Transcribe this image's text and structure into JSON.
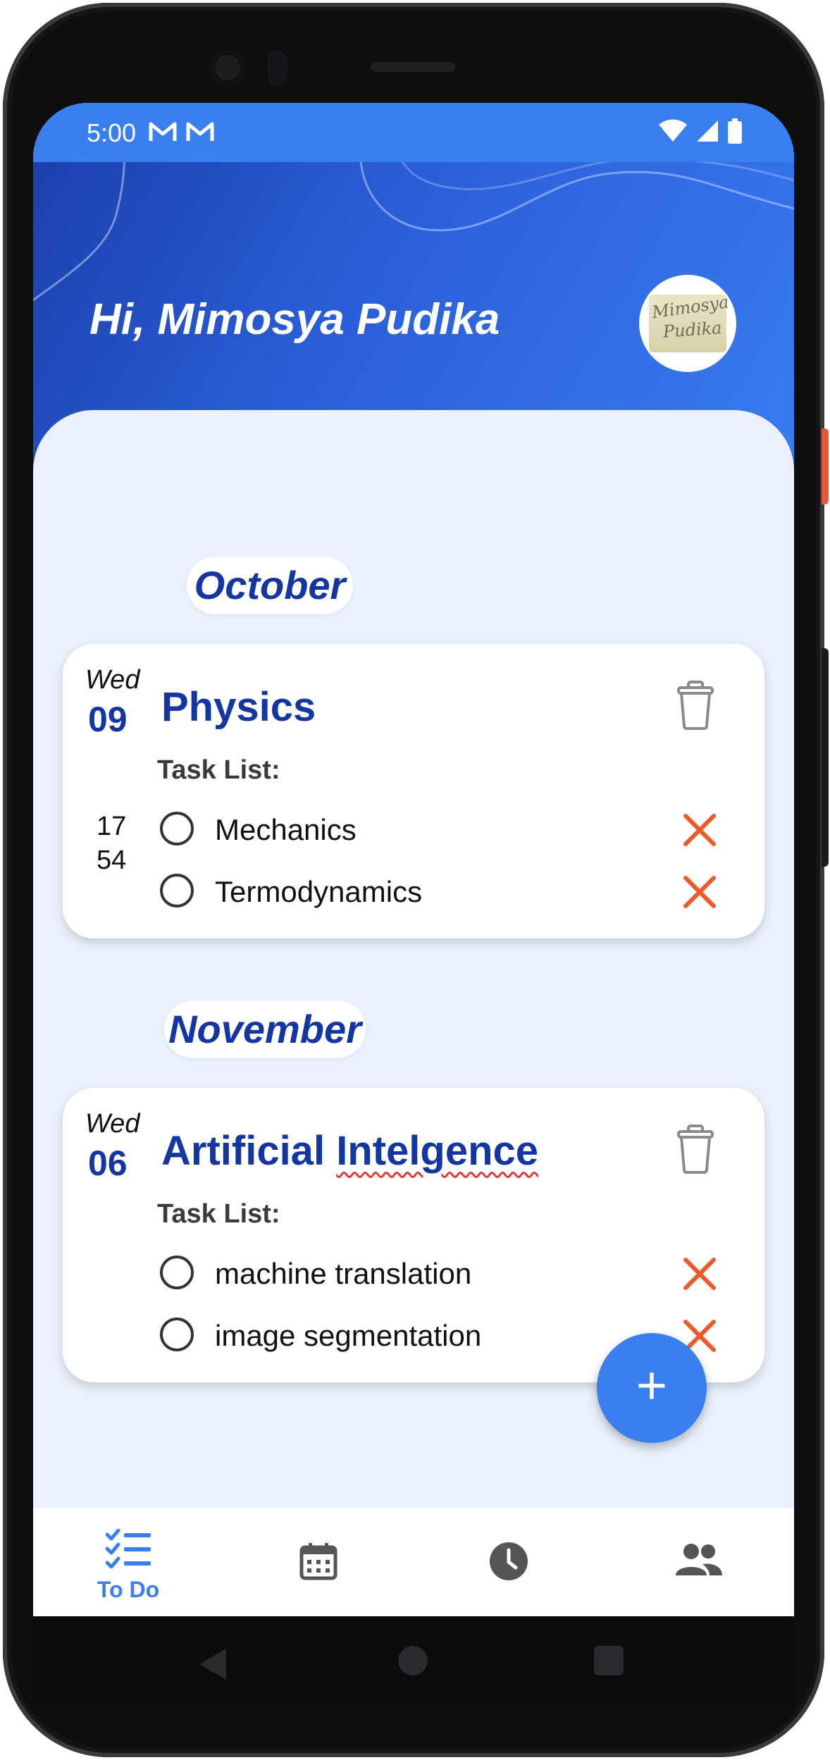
{
  "status_bar": {
    "time": "5:00",
    "notification_icons": [
      "gmail-icon",
      "gmail-icon"
    ],
    "system_icons": [
      "wifi-icon",
      "signal-icon",
      "battery-icon"
    ]
  },
  "header": {
    "greeting": "Hi, Mimosya Pudika",
    "avatar_text_line1": "Mimosya",
    "avatar_text_line2": "Pudika"
  },
  "months": [
    {
      "label": "October",
      "cards": [
        {
          "day_name": "Wed",
          "day_number": "09",
          "time_hour": "17",
          "time_minute": "54",
          "title": "Physics",
          "task_list_label": "Task List:",
          "tasks": [
            "Mechanics",
            "Termodynamics"
          ]
        }
      ]
    },
    {
      "label": "November",
      "cards": [
        {
          "day_name": "Wed",
          "day_number": "06",
          "title_part1": "Artificial",
          "title_part2": "Intelgence",
          "task_list_label": "Task List:",
          "tasks": [
            "machine translation",
            "image segmentation"
          ]
        }
      ]
    }
  ],
  "fab": {
    "label": "+"
  },
  "bottom_nav": {
    "active": "todo",
    "items": [
      {
        "id": "todo",
        "label": "To Do",
        "icon": "checklist-icon"
      },
      {
        "id": "calendar",
        "label": "",
        "icon": "calendar-icon"
      },
      {
        "id": "history",
        "label": "",
        "icon": "clock-icon"
      },
      {
        "id": "people",
        "label": "",
        "icon": "people-icon"
      }
    ]
  },
  "colors": {
    "primary": "#3a7ff0",
    "heading_blue": "#1436a3",
    "delete_x": "#f05a2b",
    "background": "#ebf1fc"
  }
}
